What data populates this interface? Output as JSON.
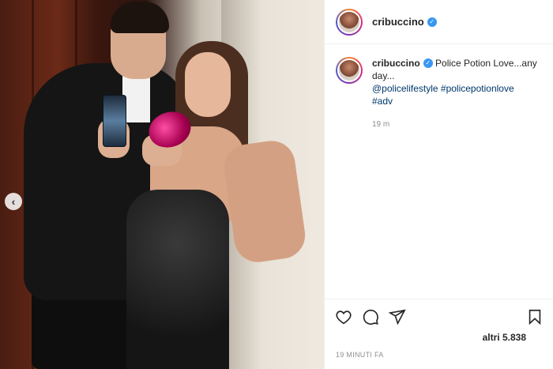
{
  "post": {
    "username": "cribuccino",
    "caption_text": "Police Potion Love...any day...",
    "tags": [
      "@policelifestyle",
      "#policepotionlove",
      "#adv"
    ],
    "time_ago": "19 m",
    "likes_text": "altri 5.838",
    "posted_label": "19 MINUTI FA"
  },
  "icons": {
    "verified": "verified-badge-icon",
    "like": "heart-icon",
    "comment": "comment-icon",
    "share": "paper-plane-icon",
    "save": "bookmark-icon",
    "prev": "chevron-left-icon"
  },
  "colors": {
    "verified_blue": "#3897f0",
    "tag_blue": "#00376b",
    "muted": "#8e8e8e"
  }
}
